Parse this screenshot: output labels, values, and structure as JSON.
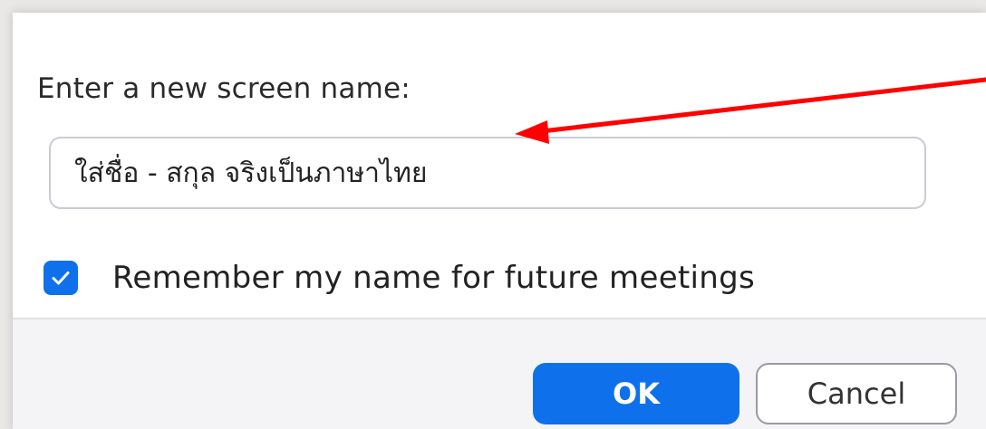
{
  "dialog": {
    "prompt_label": "Enter a new screen name:",
    "name_input": {
      "value": "ใส่ชื่อ - สกุล จริงเป็นภาษาไทย",
      "placeholder": ""
    },
    "remember_checkbox": {
      "checked": true,
      "label": "Remember my name for future meetings"
    },
    "buttons": {
      "ok_label": "OK",
      "cancel_label": "Cancel"
    }
  },
  "annotation": {
    "arrow_color": "#ff0000"
  },
  "colors": {
    "accent": "#0e71eb",
    "backdrop": "#eae8e6",
    "footer": "#f4f4f6"
  },
  "icons": {
    "checkbox": "checkmark-icon",
    "annotation": "red-arrow-icon"
  }
}
